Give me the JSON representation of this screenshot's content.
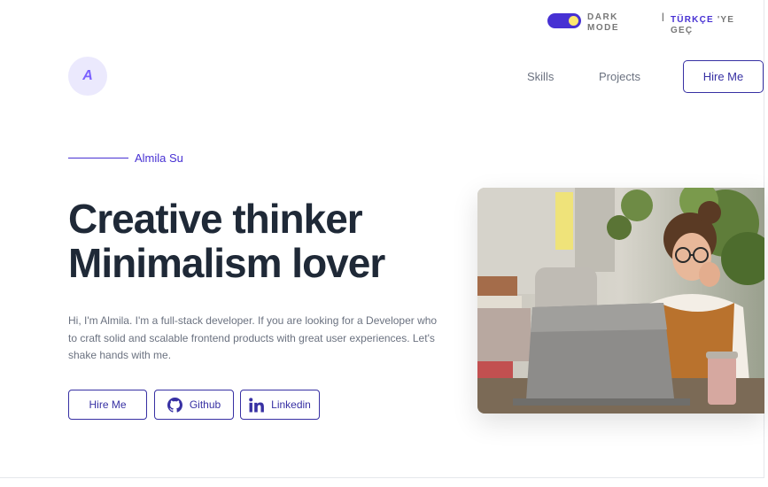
{
  "topbar": {
    "dark_mode_label": "DARK MODE",
    "separator": "|",
    "lang_highlight": "TÜRKÇE",
    "lang_rest": "'YE GEÇ"
  },
  "logo": {
    "letter": "A"
  },
  "nav": {
    "skills": "Skills",
    "projects": "Projects",
    "hire": "Hire Me"
  },
  "hero": {
    "name": "Almila Su",
    "headline_1": "Creative thinker",
    "headline_2": "Minimalism lover",
    "description": "Hi, I'm Almila. I'm a full-stack developer. If you are looking for a Developer who to craft solid and scalable frontend products with great user experiences. Let's shake hands with me.",
    "buttons": {
      "hire": "Hire Me",
      "github": "Github",
      "linkedin": "Linkedin"
    }
  },
  "icons": {
    "github": "github-icon",
    "linkedin": "linkedin-icon"
  },
  "colors": {
    "accent": "#4731d3",
    "button_border": "#3730a3",
    "headline": "#1f2937",
    "muted": "#6b7280",
    "toggle_knob": "#ffe86e"
  }
}
